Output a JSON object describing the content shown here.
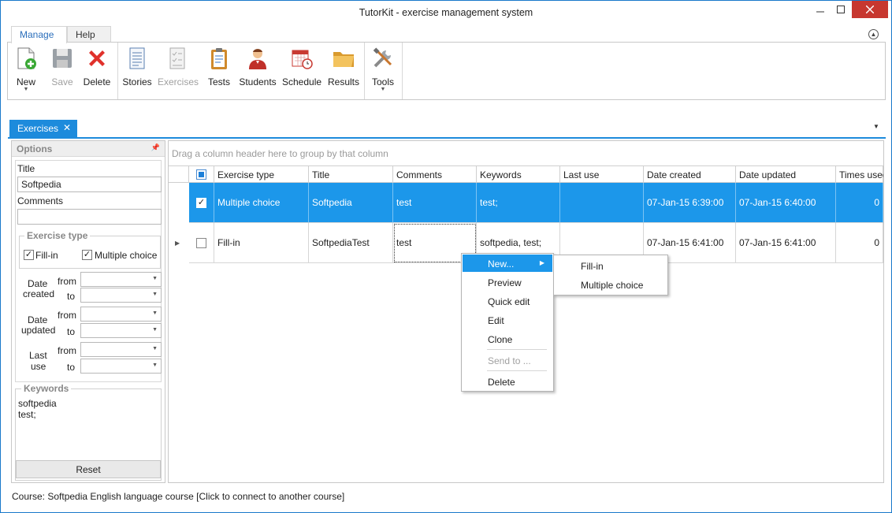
{
  "window": {
    "title": "TutorKit - exercise management system"
  },
  "ribbon": {
    "tabs": [
      "Manage",
      "Help"
    ],
    "buttons": {
      "new": "New",
      "save": "Save",
      "delete": "Delete",
      "stories": "Stories",
      "exercises": "Exercises",
      "tests": "Tests",
      "students": "Students",
      "schedule": "Schedule",
      "results": "Results",
      "tools": "Tools"
    }
  },
  "doc_tab": {
    "label": "Exercises"
  },
  "options": {
    "header": "Options",
    "title_label": "Title",
    "title_value": "Softpedia",
    "comments_label": "Comments",
    "comments_value": "",
    "exercise_type": {
      "label": "Exercise type",
      "fill_in": "Fill-in",
      "multiple_choice": "Multiple choice",
      "fill_in_checked": true,
      "multiple_choice_checked": true
    },
    "date_created": {
      "label_1": "Date",
      "label_2": "created",
      "from": "from",
      "to": "to"
    },
    "date_updated": {
      "label_1": "Date",
      "label_2": "updated",
      "from": "from",
      "to": "to"
    },
    "last_use": {
      "label_1": "Last",
      "label_2": "use",
      "from": "from",
      "to": "to"
    },
    "keywords": {
      "label": "Keywords",
      "values": [
        "softpedia",
        "test;"
      ]
    },
    "reset": "Reset"
  },
  "grid": {
    "group_hint": "Drag a column header here to group by that column",
    "columns": [
      "Exercise type",
      "Title",
      "Comments",
      "Keywords",
      "Last use",
      "Date created",
      "Date updated",
      "Times used"
    ],
    "rows": [
      {
        "checked": true,
        "exercise_type": "Multiple choice",
        "title": "Softpedia",
        "comments": "test",
        "keywords": "test;",
        "last_use": "",
        "date_created": "07-Jan-15 6:39:00",
        "date_updated": "07-Jan-15 6:40:00",
        "times_used": "0"
      },
      {
        "checked": false,
        "exercise_type": "Fill-in",
        "title": "SoftpediaTest",
        "comments": "test",
        "keywords": "softpedia, test;",
        "last_use": "",
        "date_created": "07-Jan-15 6:41:00",
        "date_updated": "07-Jan-15 6:41:00",
        "times_used": "0"
      }
    ]
  },
  "context_menu": {
    "items": [
      "New...",
      "Preview",
      "Quick edit",
      "Edit",
      "Clone",
      "Send to ...",
      "Delete"
    ],
    "submenu": [
      "Fill-in",
      "Multiple choice"
    ]
  },
  "status": "Course: Softpedia English language course [Click to connect to another course]",
  "colors": {
    "accent": "#1c97ea",
    "close": "#c7372f"
  }
}
